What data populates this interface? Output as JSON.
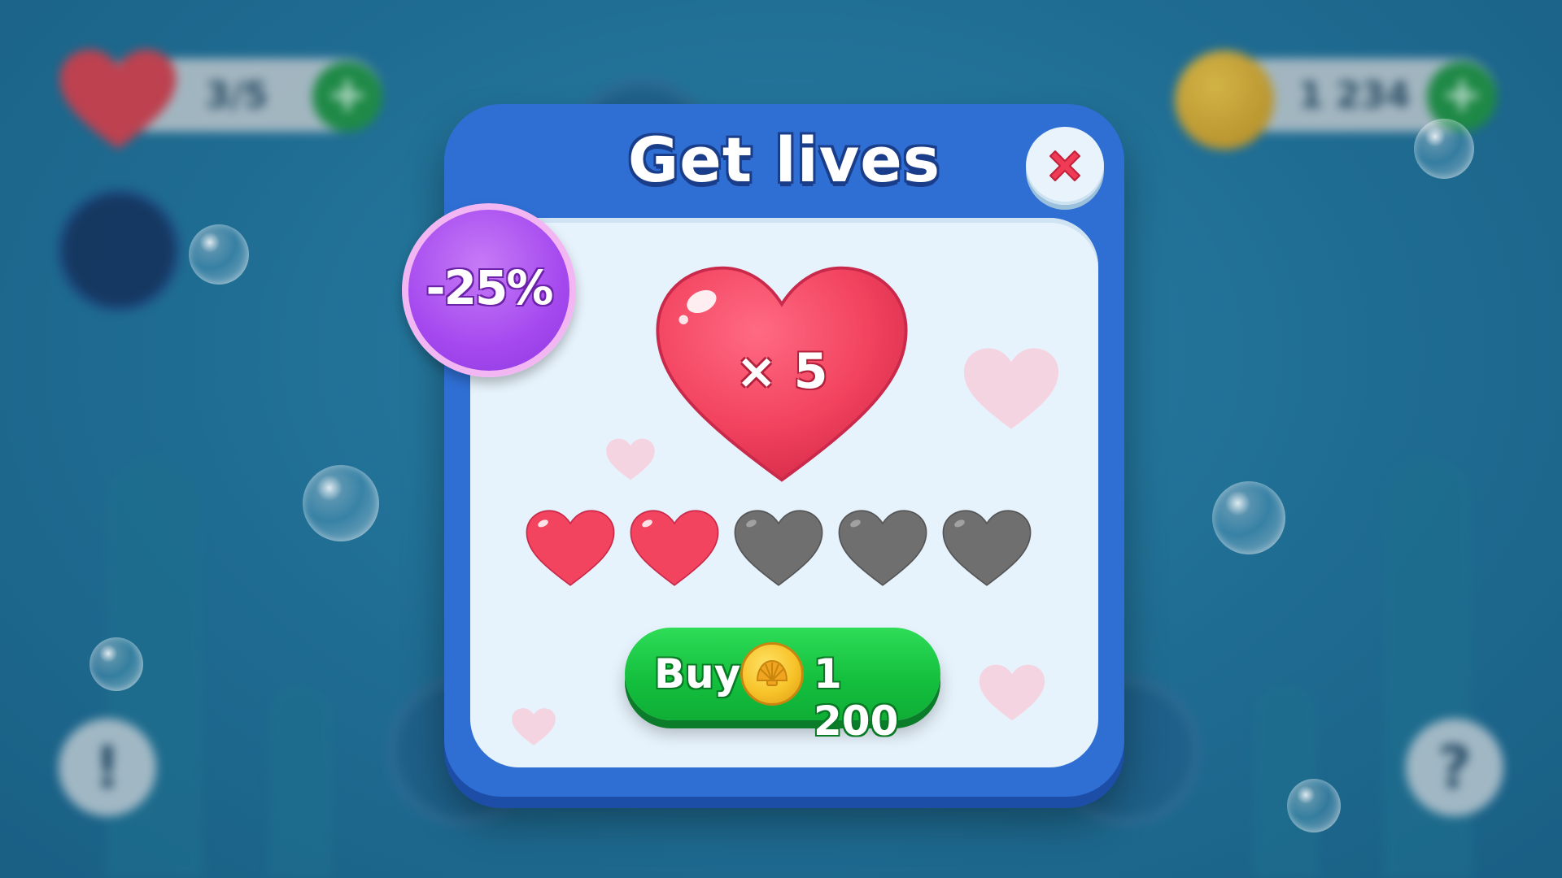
{
  "background": {
    "hud": {
      "lives_text": "3/5",
      "coins_text": "1 234",
      "plus_symbol": "+"
    },
    "buttons": {
      "info_symbol": "!",
      "help_symbol": "?"
    }
  },
  "modal": {
    "title": "Get lives",
    "discount": "-25%",
    "pack_label": "× 5",
    "lives": {
      "filled": 2,
      "total": 5
    },
    "buy_button": {
      "label": "Buy",
      "price": "1 200"
    }
  },
  "colors": {
    "modal_frame": "#2f6fd4",
    "panel": "#e7f3fc",
    "heart_red": "#f2435f",
    "heart_empty": "#6f6f6f",
    "discount_purple": "#a549ef",
    "buy_green": "#14c03e",
    "coin_gold": "#f7c32a"
  },
  "icons": {
    "close": "close-x-icon",
    "coin": "shell-coin-icon",
    "heart": "heart-icon"
  }
}
